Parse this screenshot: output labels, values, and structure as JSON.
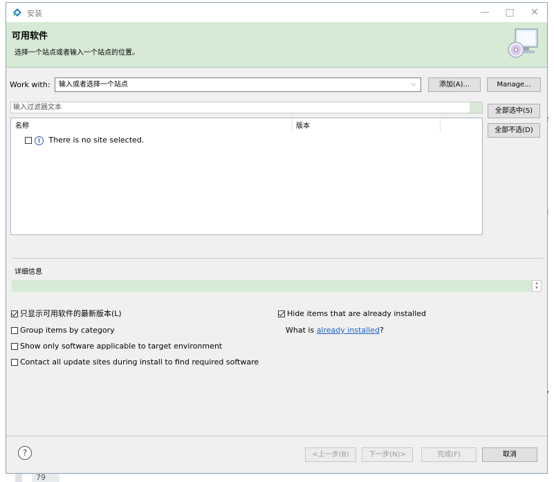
{
  "window": {
    "title": "安装",
    "minimize_glyph": "—",
    "maximize_glyph": "□",
    "close_glyph": "✕",
    "accent": "#1e7fd6"
  },
  "banner": {
    "title": "可用软件",
    "subtitle": "选择一个站点或者输入一个站点的位置。",
    "art_icon": "install-cd-monitor-icon",
    "background": "#d6ead6"
  },
  "work_with": {
    "label": "Work with:",
    "value": "输入或者选择一个站点",
    "add_label": "添加(A)...",
    "manage_label": "Manage..."
  },
  "filter": {
    "placeholder": "输入过滤器文本"
  },
  "selection_buttons": {
    "select_all": "全部选中(S)",
    "deselect_all": "全部不选(D)"
  },
  "table": {
    "columns": [
      "名称",
      "版本"
    ],
    "rows": [
      {
        "text": "There is no site selected.",
        "checked": false,
        "icon": "info-icon"
      }
    ]
  },
  "details": {
    "label": "详细信息"
  },
  "options": {
    "show_latest": {
      "label": "只显示可用软件的最新版本(L)",
      "checked": true
    },
    "group_by_category": {
      "label": "Group items by category",
      "checked": false
    },
    "show_applicable": {
      "label": "Show only software applicable to target environment",
      "checked": false
    },
    "contact_all": {
      "label": "Contact all update sites during install to find required software",
      "checked": false
    },
    "hide_installed": {
      "label": "Hide items that are already installed",
      "checked": true
    },
    "what_is_prefix": "What is ",
    "what_is_link": "already installed",
    "what_is_suffix": "?"
  },
  "footer": {
    "help_glyph": "?",
    "back": "<上一步(B)",
    "next": "下一步(N)>",
    "finish": "完成(F)",
    "cancel": "取消"
  },
  "background_peek": {
    "a": "?",
    "b": "r",
    "c": "e",
    "d": "a",
    "e": "r",
    "f": "),",
    "g": "79"
  }
}
